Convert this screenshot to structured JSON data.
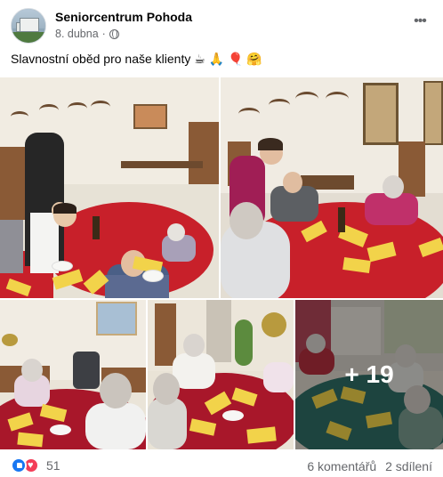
{
  "post": {
    "page_name": "Seniorcentrum Pohoda",
    "date": "8. dubna",
    "separator": "·",
    "audience_icon": "globe-icon",
    "more_icon": "more-options-icon",
    "caption": "Slavnostní oběd pro naše klienty ☕ 🙏 🎈 🤗"
  },
  "photos": {
    "more_count": "+ 19"
  },
  "footer": {
    "reaction_icons": [
      "like-icon",
      "love-icon"
    ],
    "reaction_count": "51",
    "comments": "6 komentářů",
    "shares": "2 sdílení"
  },
  "colors": {
    "like_blue": "#1877f2",
    "love_red": "#f33e58",
    "tablecloth_red": "#c8202a",
    "tablecloth_teal": "#2f6f66",
    "napkin_yellow": "#f2d34a"
  }
}
